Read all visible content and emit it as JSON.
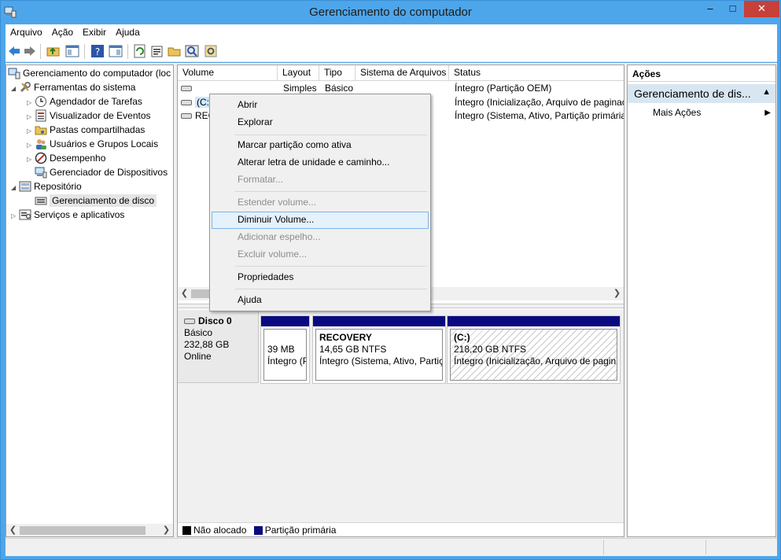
{
  "window": {
    "title": "Gerenciamento do computador",
    "minimize": "–",
    "maximize": "□",
    "close": "✕"
  },
  "menu": [
    "Arquivo",
    "Ação",
    "Exibir",
    "Ajuda"
  ],
  "toolbar": [
    "back-icon",
    "forward-icon",
    "folder-up-icon",
    "show-hide-tree-icon",
    "help-icon",
    "action-pane-icon",
    "refresh-icon",
    "properties-icon",
    "open-folder-icon",
    "search-icon",
    "settings-icon"
  ],
  "tree": {
    "root": "Gerenciamento do computador (loc",
    "items": [
      "Ferramentas do sistema",
      "Agendador de Tarefas",
      "Visualizador de Eventos",
      "Pastas compartilhadas",
      "Usuários e Grupos Locais",
      "Desempenho",
      "Gerenciador de Dispositivos",
      "Repositório",
      "Gerenciamento de disco",
      "Serviços e aplicativos"
    ]
  },
  "volumes": {
    "columns": [
      "Volume",
      "Layout",
      "Tipo",
      "Sistema de Arquivos",
      "Status"
    ],
    "rows": [
      {
        "volume": "",
        "layout": "Simples",
        "tipo": "Básico",
        "fs": "",
        "status": "Íntegro (Partição OEM)"
      },
      {
        "volume": "(C:)",
        "layout": "",
        "tipo": "",
        "fs": "",
        "status": "Íntegro (Inicialização, Arquivo de paginaç"
      },
      {
        "volume": "REC",
        "layout": "",
        "tipo": "",
        "fs": "",
        "status": "Íntegro (Sistema, Ativo, Partição primária"
      }
    ]
  },
  "disk": {
    "name": "Disco 0",
    "type": "Básico",
    "size": "232,88 GB",
    "state": "Online",
    "partitions": [
      {
        "name": "",
        "size": "39 MB",
        "status": "Íntegro (P"
      },
      {
        "name": "RECOVERY",
        "size": "14,65 GB NTFS",
        "status": "Íntegro (Sistema, Ativo, Partiç"
      },
      {
        "name": "(C:)",
        "size": "218,20 GB NTFS",
        "status": "Íntegro (Inicialização, Arquivo de pagin"
      }
    ]
  },
  "legend": {
    "unallocated": "Não alocado",
    "primary": "Partição primária"
  },
  "actions": {
    "header": "Ações",
    "group": "Gerenciamento de dis...",
    "more": "Mais Ações"
  },
  "context_menu": {
    "open": "Abrir",
    "explore": "Explorar",
    "mark_active": "Marcar partição como ativa",
    "change_letter": "Alterar letra de unidade e caminho...",
    "format": "Formatar...",
    "extend": "Estender volume...",
    "shrink": "Diminuir Volume...",
    "add_mirror": "Adicionar espelho...",
    "delete": "Excluir volume...",
    "properties": "Propriedades",
    "help": "Ajuda"
  },
  "colors": {
    "primary_partition": "#0a0a80",
    "unallocated": "#000000",
    "highlight": "#e5f1fb",
    "titlebar": "#4ea6ea"
  }
}
